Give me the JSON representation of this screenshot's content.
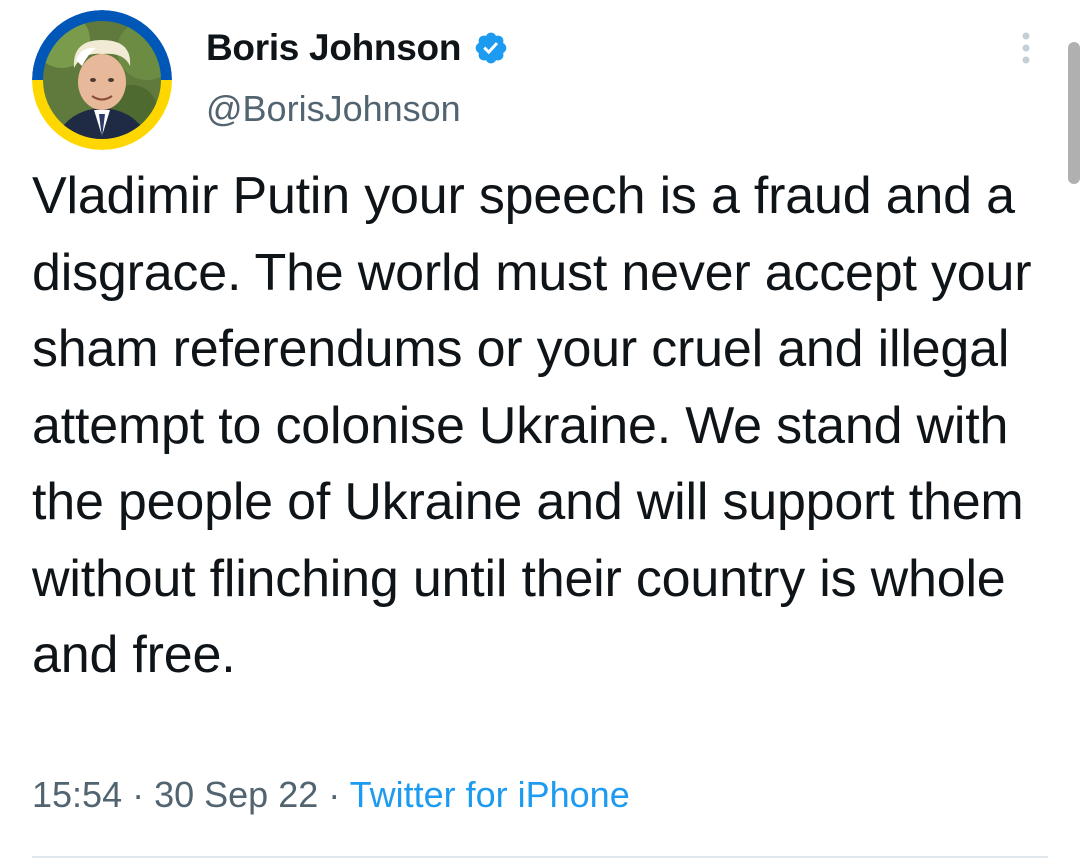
{
  "user": {
    "display_name": "Boris Johnson",
    "handle": "@BorisJohnson",
    "verified": true,
    "avatar_icon": "profile-photo",
    "avatar_ring_colors": [
      "#0057b7",
      "#ffd700"
    ]
  },
  "tweet": {
    "text": "Vladimir Putin your speech is a fraud and a disgrace. The world must never accept your sham referendums or your cruel and illegal attempt to colonise Ukraine. We stand with the people of Ukraine and will support them without flinching until their country is whole and free."
  },
  "meta": {
    "time": "15:54",
    "separator": " · ",
    "date": "30 Sep 22",
    "source": "Twitter for iPhone"
  },
  "icons": {
    "verified": "verified-badge-icon",
    "more": "more-vertical-icon"
  },
  "colors": {
    "text": "#0f1419",
    "secondary": "#536471",
    "link": "#1d9bf0",
    "verified": "#1d9bf0"
  }
}
